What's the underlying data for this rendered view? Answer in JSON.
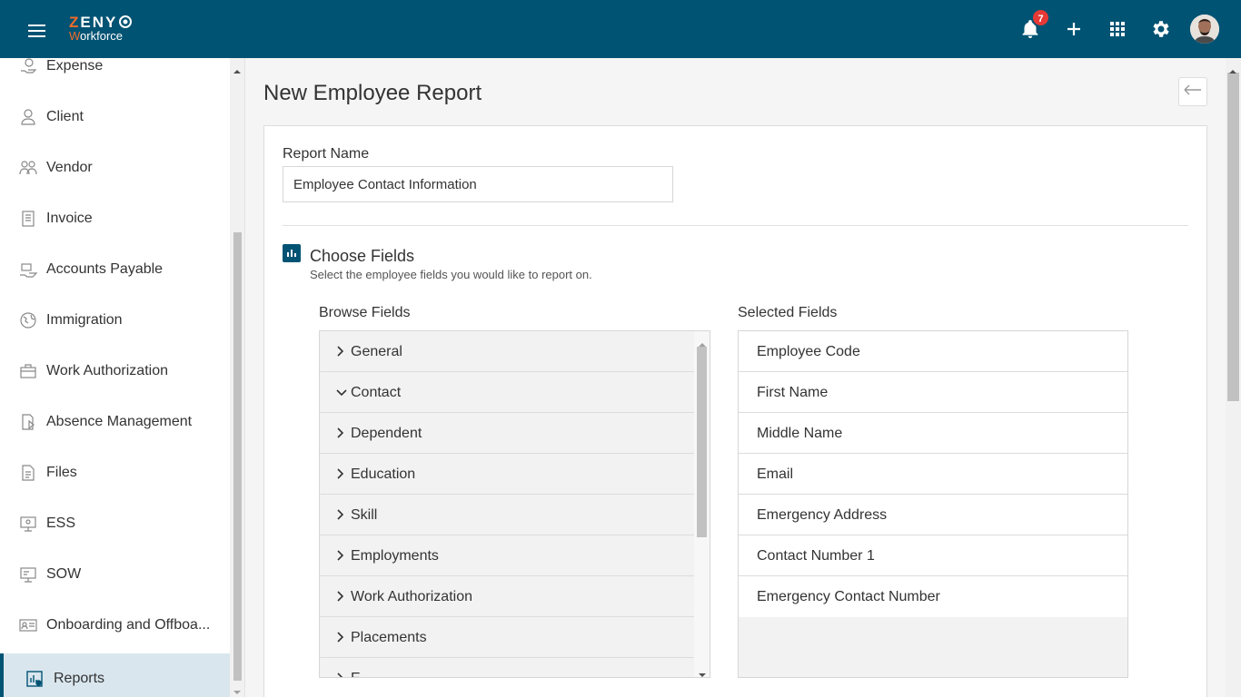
{
  "header": {
    "logo_brand_first": "Z",
    "logo_brand_rest": "ENY",
    "logo_sub_first": "W",
    "logo_sub_rest": "orkforce",
    "notification_count": "7",
    "icons": [
      "menu-icon",
      "bell-icon",
      "plus-icon",
      "apps-grid-icon",
      "gear-icon",
      "avatar"
    ]
  },
  "sidebar": {
    "items": [
      {
        "label": "Expense",
        "icon": "expense-icon"
      },
      {
        "label": "Client",
        "icon": "client-icon"
      },
      {
        "label": "Vendor",
        "icon": "vendor-icon"
      },
      {
        "label": "Invoice",
        "icon": "invoice-icon"
      },
      {
        "label": "Accounts Payable",
        "icon": "accounts-payable-icon"
      },
      {
        "label": "Immigration",
        "icon": "globe-icon"
      },
      {
        "label": "Work Authorization",
        "icon": "briefcase-icon"
      },
      {
        "label": "Absence Management",
        "icon": "absence-icon"
      },
      {
        "label": "Files",
        "icon": "file-icon"
      },
      {
        "label": "ESS",
        "icon": "ess-icon"
      },
      {
        "label": "SOW",
        "icon": "sow-icon"
      },
      {
        "label": "Onboarding and Offboa...",
        "icon": "id-card-icon"
      },
      {
        "label": "Reports",
        "icon": "report-icon",
        "active": true
      }
    ]
  },
  "main": {
    "title": "New Employee Report",
    "report_name_label": "Report Name",
    "report_name_value": "Employee Contact Information",
    "choose_fields_title": "Choose Fields",
    "choose_fields_subtitle": "Select the employee fields you would like to report on.",
    "browse_label": "Browse Fields",
    "selected_label": "Selected Fields",
    "browse_fields": [
      {
        "label": "General",
        "expanded": false
      },
      {
        "label": "Contact",
        "expanded": true
      },
      {
        "label": "Dependent",
        "expanded": false
      },
      {
        "label": "Education",
        "expanded": false
      },
      {
        "label": "Skill",
        "expanded": false
      },
      {
        "label": "Employments",
        "expanded": false
      },
      {
        "label": "Work Authorization",
        "expanded": false
      },
      {
        "label": "Placements",
        "expanded": false
      },
      {
        "label": "E",
        "expanded": false
      }
    ],
    "selected_fields": [
      "Employee Code",
      "First Name",
      "Middle Name",
      "Email",
      "Emergency Address",
      "Contact Number 1",
      "Emergency Contact Number"
    ]
  },
  "colors": {
    "header_bg": "#005373",
    "accent_orange": "#f26b2a",
    "badge_red": "#e53935",
    "active_nav_bg": "#d9e6ee"
  }
}
